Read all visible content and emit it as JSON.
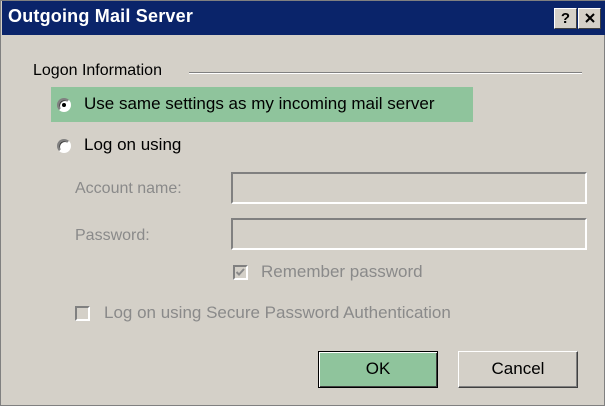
{
  "window": {
    "title": "Outgoing Mail Server",
    "help_button": "?",
    "close_icon": "close-icon"
  },
  "logon": {
    "group_label": "Logon Information",
    "option_same": "Use same settings as my incoming mail server",
    "option_logon": "Log on using",
    "selected_option": "same",
    "account_label": "Account name:",
    "account_value": "",
    "password_label": "Password:",
    "password_value": "",
    "remember_label": "Remember password",
    "remember_checked": true,
    "spa_label": "Log on using Secure Password Authentication",
    "spa_checked": false
  },
  "buttons": {
    "ok": "OK",
    "cancel": "Cancel"
  },
  "colors": {
    "titlebar": "#0a246a",
    "highlight": "#8fc49c",
    "dialog": "#d4d0c8"
  }
}
